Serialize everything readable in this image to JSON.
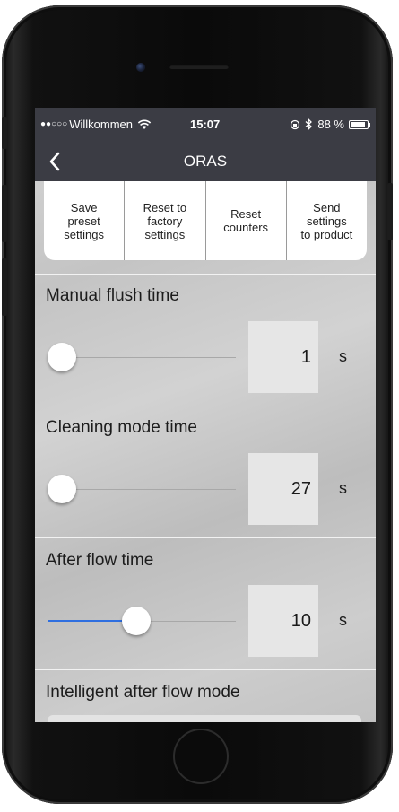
{
  "status_bar": {
    "signal_dots": "●●○○○",
    "carrier": "Willkommen",
    "time": "15:07",
    "battery_percent": "88 %",
    "battery_level": 0.88
  },
  "nav": {
    "title": "ORAS"
  },
  "actions": [
    {
      "label": "Save\npreset\nsettings"
    },
    {
      "label": "Reset to\nfactory\nsettings"
    },
    {
      "label": "Reset\ncounters"
    },
    {
      "label": "Send\nsettings\nto product"
    }
  ],
  "settings": {
    "manual_flush": {
      "title": "Manual flush time",
      "value": "1",
      "unit": "s",
      "slider_fraction": 0.0
    },
    "cleaning_mode": {
      "title": "Cleaning mode time",
      "value": "27",
      "unit": "s",
      "slider_fraction": 0.02
    },
    "after_flow": {
      "title": "After flow time",
      "value": "10",
      "unit": "s",
      "slider_fraction": 0.47
    },
    "intelligent_after_flow": {
      "title": "Intelligent after flow mode"
    }
  },
  "colors": {
    "header": "#3b3c44",
    "slider_accent": "#2f6fe0"
  }
}
